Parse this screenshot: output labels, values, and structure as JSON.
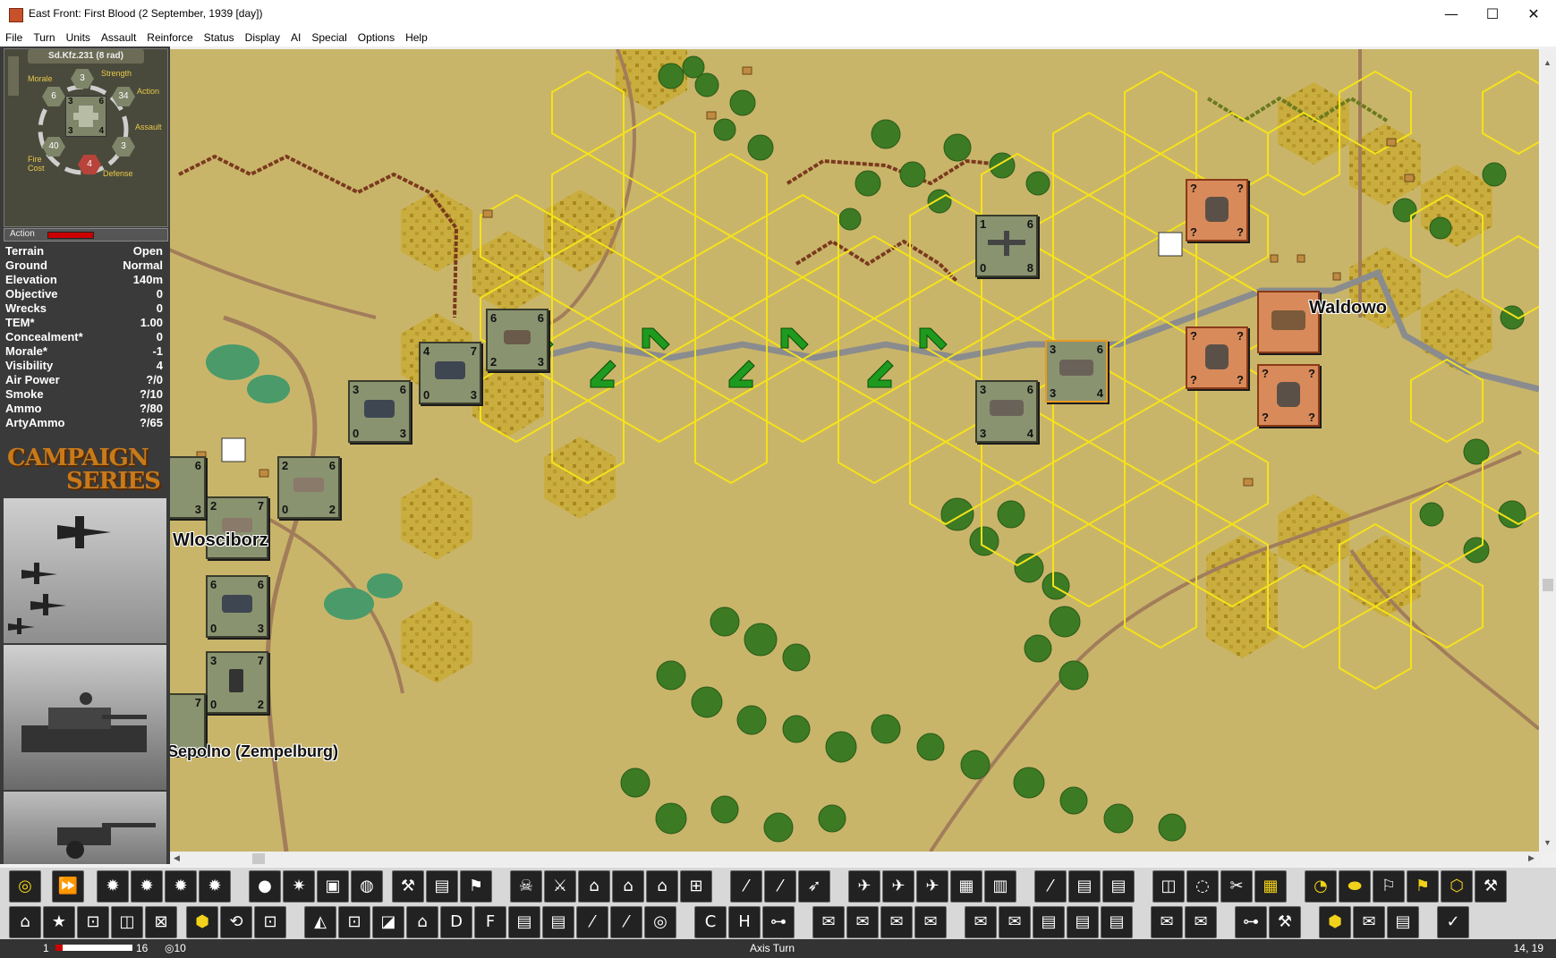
{
  "window": {
    "title": "East Front: First Blood (2 September, 1939 [day])",
    "minimize": "—",
    "maximize": "☐",
    "close": "✕"
  },
  "menu": [
    "File",
    "Turn",
    "Units",
    "Assault",
    "Reinforce",
    "Status",
    "Display",
    "AI",
    "Special",
    "Options",
    "Help"
  ],
  "unit_card": {
    "name": "Sd.Kfz.231 (8 rad)",
    "strength_label": "Strength",
    "strength": "3",
    "morale_label": "Morale",
    "morale": "6",
    "action_label": "Action",
    "action": "34",
    "assault_label": "Assault",
    "assault": "3",
    "fire_cost_label": "Fire Cost",
    "fire_cost": "40",
    "defense_label": "Defense",
    "defense": "4",
    "counter_tl": "3",
    "counter_tr": "6",
    "counter_bl": "3",
    "counter_br": "4",
    "action_bar_label": "Action"
  },
  "stats": [
    {
      "label": "Terrain",
      "value": "Open"
    },
    {
      "label": "Ground",
      "value": "Normal"
    },
    {
      "label": "Elevation",
      "value": "140m"
    },
    {
      "label": "Objective",
      "value": "0"
    },
    {
      "label": "Wrecks",
      "value": "0"
    },
    {
      "label": "TEM*",
      "value": "1.00"
    },
    {
      "label": "Concealment*",
      "value": "0"
    },
    {
      "label": "Morale*",
      "value": "-1"
    },
    {
      "label": "Visibility",
      "value": "4"
    },
    {
      "label": "Air Power",
      "value": "?/0"
    },
    {
      "label": "Smoke",
      "value": "?/10"
    },
    {
      "label": "Ammo",
      "value": "?/80"
    },
    {
      "label": "ArtyAmmo",
      "value": "?/65"
    }
  ],
  "logo": {
    "line1": "CAMPAIGN",
    "line2": "SERIES"
  },
  "map": {
    "towns": [
      "Waldowo",
      "Wlosciborz",
      "Sepolno (Zempelburg)"
    ],
    "german_units": [
      {
        "tl": "6",
        "tr": "6",
        "bl": "2",
        "br": "3"
      },
      {
        "tl": "4",
        "tr": "7",
        "bl": "0",
        "br": "3"
      },
      {
        "tl": "3",
        "tr": "6",
        "bl": "0",
        "br": "3"
      },
      {
        "tl": "2",
        "tr": "6",
        "bl": "0",
        "br": "2"
      },
      {
        "tl": "2",
        "tr": "7",
        "bl": "",
        "br": ""
      },
      {
        "tl": "6",
        "tr": "6",
        "bl": "0",
        "br": "3"
      },
      {
        "tl": "3",
        "tr": "7",
        "bl": "0",
        "br": "2"
      },
      {
        "tl": "",
        "tr": "6",
        "bl": "",
        "br": "3"
      },
      {
        "tl": "",
        "tr": "7",
        "bl": "",
        "br": ""
      },
      {
        "tl": "1",
        "tr": "6",
        "bl": "0",
        "br": "8"
      },
      {
        "tl": "3",
        "tr": "6",
        "bl": "3",
        "br": "4"
      },
      {
        "tl": "3",
        "tr": "6",
        "bl": "3",
        "br": "4"
      }
    ],
    "polish_units": [
      {
        "tl": "?",
        "tr": "?",
        "bl": "?",
        "br": "?"
      },
      {
        "tl": "",
        "tr": "",
        "bl": "",
        "br": ""
      },
      {
        "tl": "?",
        "tr": "?",
        "bl": "?",
        "br": "?"
      },
      {
        "tl": "?",
        "tr": "?",
        "bl": "?",
        "br": "?"
      }
    ]
  },
  "status": {
    "left_num": "1",
    "val16": "16",
    "val10": "10",
    "turn": "Axis Turn",
    "coord": "14, 19"
  },
  "colors": {
    "hex_highlight": "#f5e21a",
    "terrain": "#c9b56a",
    "german_counter": "#8a9370",
    "polish_counter": "#d98a5a",
    "move_arrow": "#1e9a1e"
  }
}
